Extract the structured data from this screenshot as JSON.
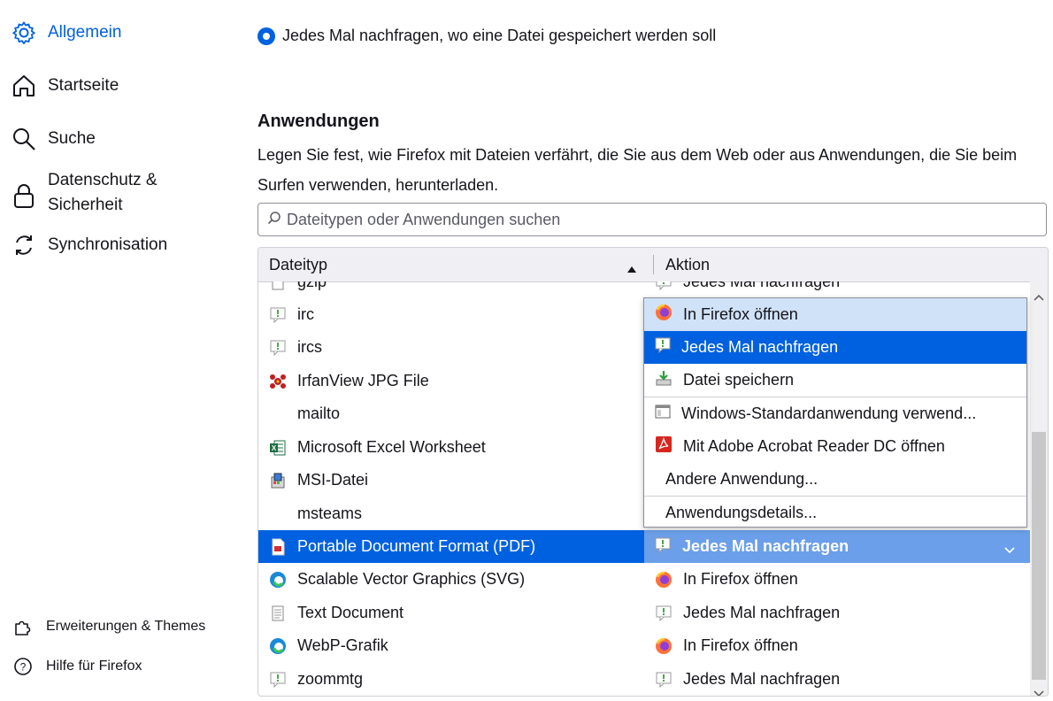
{
  "sidebar": {
    "items": [
      {
        "label": "Allgemein",
        "icon": "gear-icon",
        "active": true
      },
      {
        "label": "Startseite",
        "icon": "home-icon"
      },
      {
        "label": "Suche",
        "icon": "search-icon"
      },
      {
        "label": "Datenschutz &",
        "label2": "Sicherheit",
        "icon": "lock-icon"
      },
      {
        "label": "Synchronisation",
        "icon": "sync-icon"
      }
    ],
    "footer": [
      {
        "label": "Erweiterungen & Themes",
        "icon": "puzzle-icon"
      },
      {
        "label": "Hilfe für Firefox",
        "icon": "help-icon"
      }
    ]
  },
  "download": {
    "ask_label": "Jedes Mal nachfragen, wo eine Datei gespeichert werden soll"
  },
  "applications": {
    "title": "Anwendungen",
    "description": "Legen Sie fest, wie Firefox mit Dateien verfährt, die Sie aus dem Web oder aus Anwendungen, die Sie beim Surfen verwenden, herunterladen.",
    "search_placeholder": "Dateitypen oder Anwendungen suchen",
    "columns": {
      "type": "Dateityp",
      "action": "Aktion"
    },
    "rows": [
      {
        "type": "gzip",
        "action": "Jedes Mal nachfragen",
        "type_icon": "file-icon",
        "action_icon": "ask-icon"
      },
      {
        "type": "irc",
        "action": "",
        "type_icon": "ask-icon"
      },
      {
        "type": "ircs",
        "action": "",
        "type_icon": "ask-icon"
      },
      {
        "type": "IrfanView JPG File",
        "action": "",
        "type_icon": "irfanview-icon"
      },
      {
        "type": "mailto",
        "action": "",
        "type_icon": ""
      },
      {
        "type": "Microsoft Excel Worksheet",
        "action": "",
        "type_icon": "excel-icon"
      },
      {
        "type": "MSI-Datei",
        "action": "",
        "type_icon": "msi-icon"
      },
      {
        "type": "msteams",
        "action": "",
        "type_icon": ""
      },
      {
        "type": "Portable Document Format (PDF)",
        "action": "Jedes Mal nachfragen",
        "type_icon": "pdf-icon",
        "action_icon": "ask-icon",
        "selected": true
      },
      {
        "type": "Scalable Vector Graphics (SVG)",
        "action": "In Firefox öffnen",
        "type_icon": "edge-icon",
        "action_icon": "firefox-icon"
      },
      {
        "type": "Text Document",
        "action": "Jedes Mal nachfragen",
        "type_icon": "text-file-icon",
        "action_icon": "ask-icon"
      },
      {
        "type": "WebP-Grafik",
        "action": "In Firefox öffnen",
        "type_icon": "edge-icon",
        "action_icon": "firefox-icon"
      },
      {
        "type": "zoommtg",
        "action": "Jedes Mal nachfragen",
        "type_icon": "ask-icon",
        "action_icon": "ask-icon"
      }
    ],
    "menu": [
      {
        "label": "In Firefox öffnen",
        "icon": "firefox-icon",
        "state": "hover"
      },
      {
        "label": "Jedes Mal nachfragen",
        "icon": "ask-icon",
        "state": "selected"
      },
      {
        "label": "Datei speichern",
        "icon": "save-icon"
      },
      {
        "label": "Windows-Standardanwendung verwend...",
        "icon": "window-icon"
      },
      {
        "label": "Mit Adobe Acrobat Reader DC  öffnen",
        "icon": "acrobat-icon"
      },
      {
        "label": "Andere Anwendung...",
        "icon": ""
      },
      {
        "label": "Anwendungsdetails...",
        "icon": ""
      }
    ]
  },
  "colors": {
    "accent": "#0061e0",
    "selected_action": "#6b9fe9",
    "hover": "#d0e2f8"
  }
}
